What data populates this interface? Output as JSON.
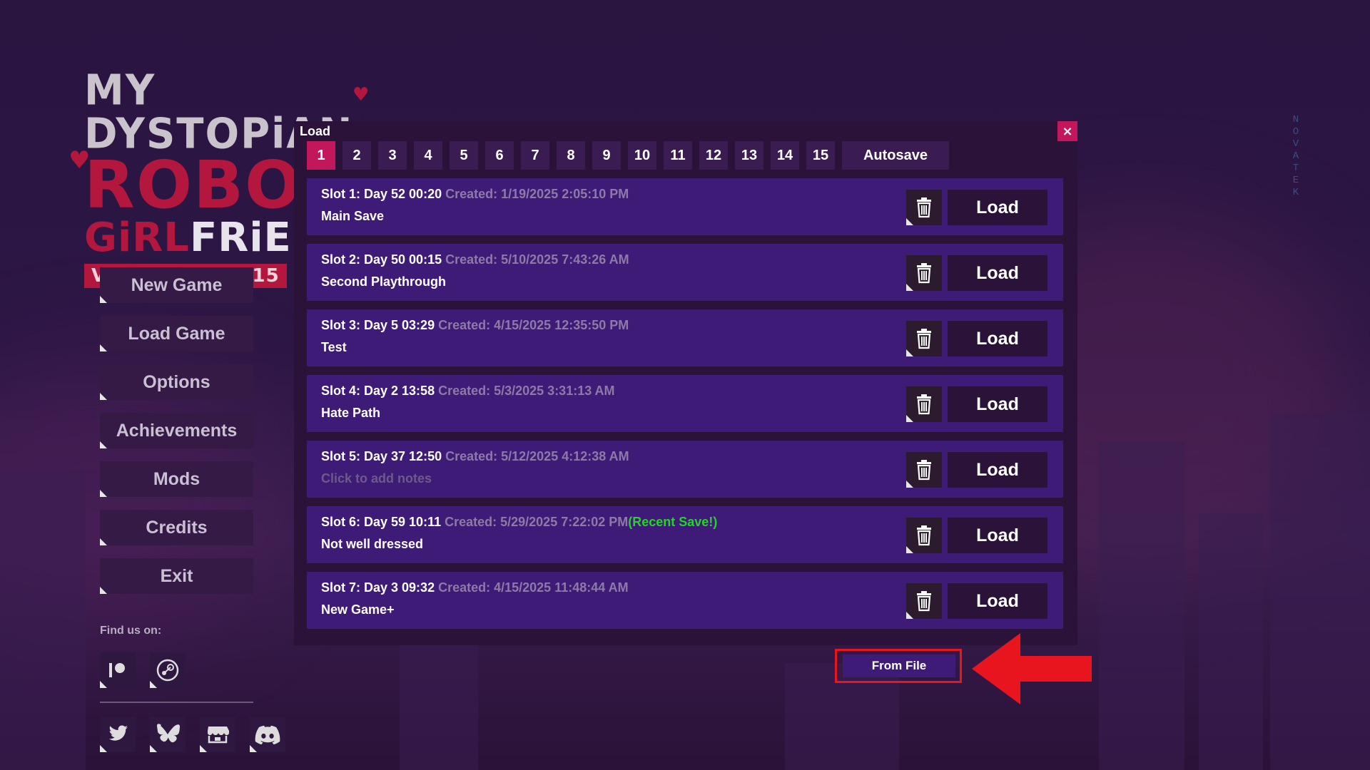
{
  "logo": {
    "line1": "MY DYSTOPiAN",
    "line2": "ROBOT",
    "line3_a": "GiRL",
    "line3_b": "FRiE",
    "version": "VERSiON 0.90.15"
  },
  "menu": {
    "items": [
      "New Game",
      "Load Game",
      "Options",
      "Achievements",
      "Mods",
      "Credits",
      "Exit"
    ]
  },
  "social": {
    "find_us": "Find us on:",
    "top_icons": [
      "patreon-icon",
      "steam-icon"
    ],
    "bottom_icons": [
      "twitter-icon",
      "bluesky-icon",
      "itch-icon",
      "discord-icon"
    ]
  },
  "side_text": "NOVATEK",
  "load_panel": {
    "title": "Load",
    "close": "×",
    "tabs": [
      "1",
      "2",
      "3",
      "4",
      "5",
      "6",
      "7",
      "8",
      "9",
      "10",
      "11",
      "12",
      "13",
      "14",
      "15"
    ],
    "autosave_tab": "Autosave",
    "active_tab": "1",
    "slots": [
      {
        "header": "Slot 1: Day 52 00:20",
        "created": "Created: 1/19/2025 2:05:10 PM",
        "recent": "",
        "note": "Main Save",
        "placeholder": false,
        "load": "Load"
      },
      {
        "header": "Slot 2: Day 50 00:15",
        "created": "Created: 5/10/2025 7:43:26 AM",
        "recent": "",
        "note": "Second Playthrough",
        "placeholder": false,
        "load": "Load"
      },
      {
        "header": "Slot 3: Day 5 03:29",
        "created": "Created: 4/15/2025 12:35:50 PM",
        "recent": "",
        "note": "Test",
        "placeholder": false,
        "load": "Load"
      },
      {
        "header": "Slot 4: Day 2 13:58",
        "created": "Created: 5/3/2025 3:31:13 AM",
        "recent": "",
        "note": "Hate Path",
        "placeholder": false,
        "load": "Load"
      },
      {
        "header": "Slot 5: Day 37 12:50",
        "created": "Created: 5/12/2025 4:12:38 AM",
        "recent": "",
        "note": "Click to add notes",
        "placeholder": true,
        "load": "Load"
      },
      {
        "header": "Slot 6: Day 59 10:11",
        "created": "Created: 5/29/2025 7:22:02 PM",
        "recent": "(Recent Save!)",
        "note": "Not well dressed",
        "placeholder": false,
        "load": "Load"
      },
      {
        "header": "Slot 7: Day 3 09:32",
        "created": "Created: 4/15/2025 11:48:44 AM",
        "recent": "",
        "note": "New Game+",
        "placeholder": false,
        "load": "Load"
      }
    ],
    "from_file": "From File"
  },
  "colors": {
    "accent": "#c2185b",
    "slot_bg": "#3f1b78",
    "recent": "#27d22c",
    "highlight": "#e8141e"
  }
}
